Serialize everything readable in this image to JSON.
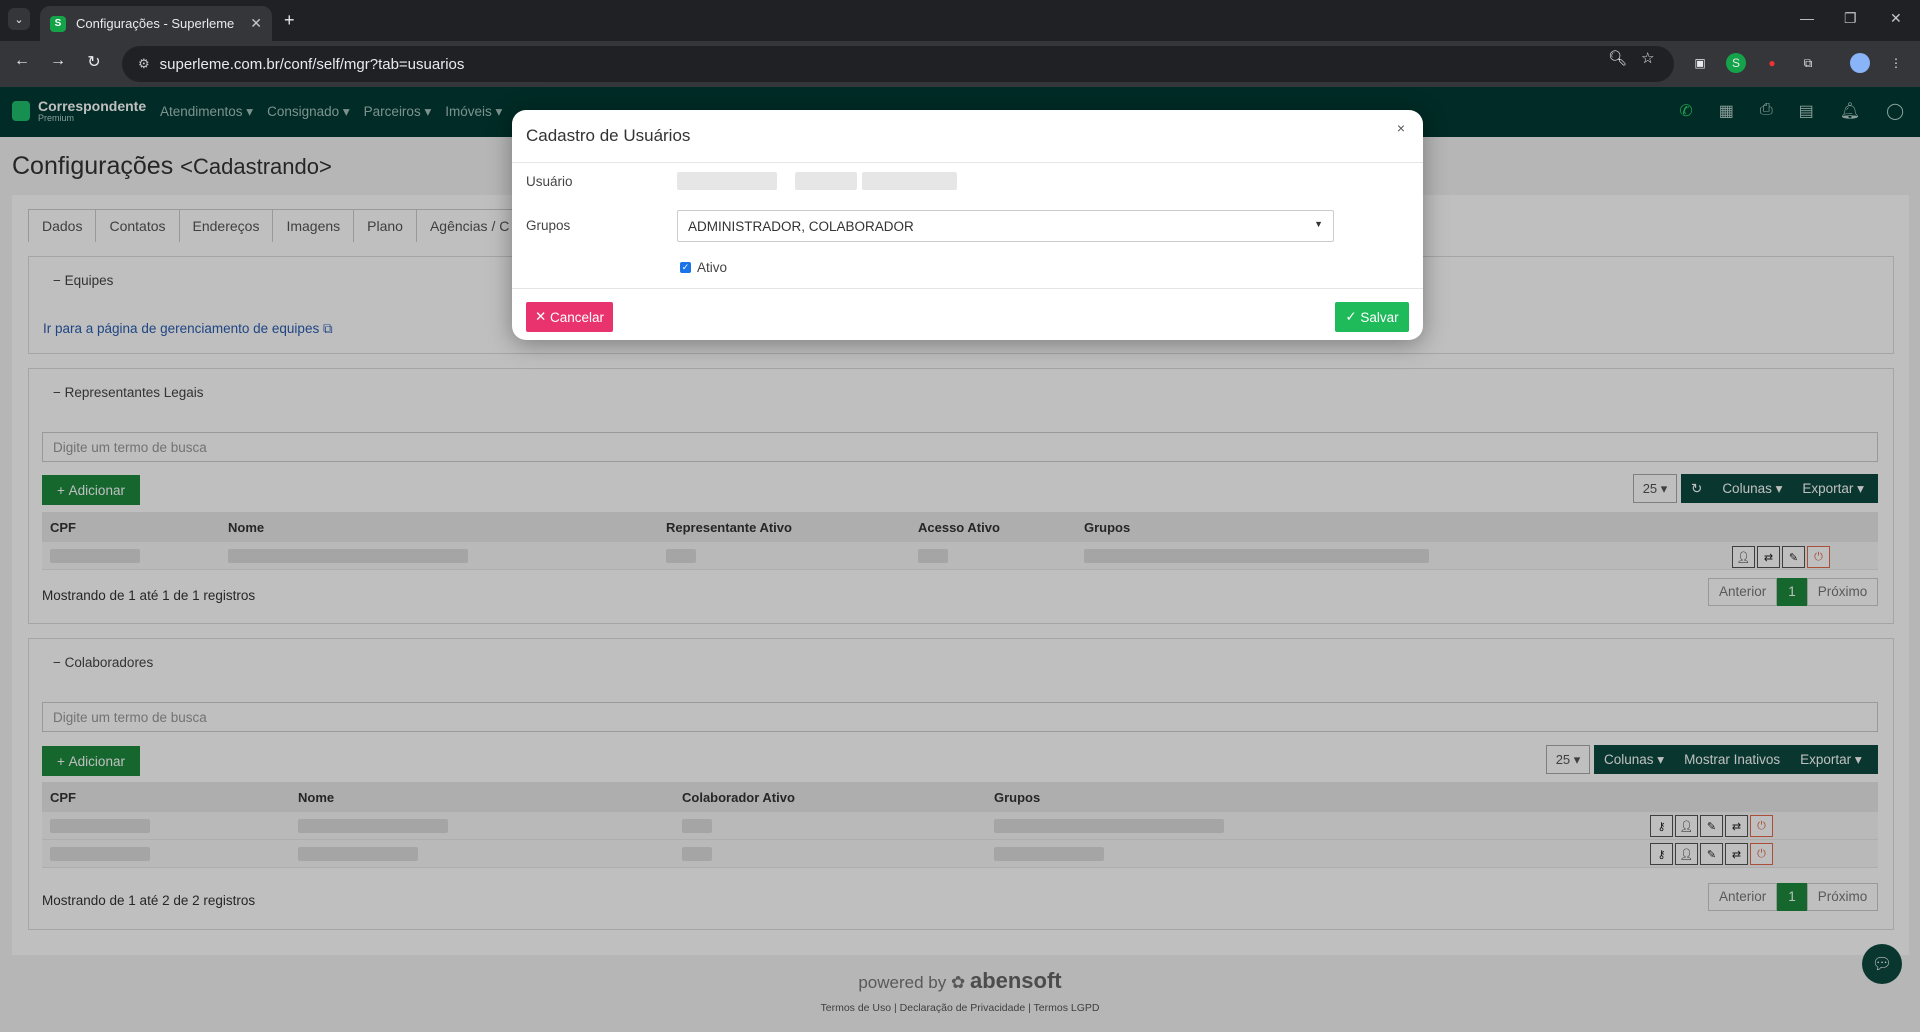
{
  "browser": {
    "tab_title": "Configurações - Superleme",
    "url": "superleme.com.br/conf/self/mgr?tab=usuarios"
  },
  "app": {
    "brand_name": "Correspondente",
    "brand_sub": "Premium",
    "menu": [
      "Atendimentos ▾",
      "Consignado ▾",
      "Parceiros ▾",
      "Imóveis ▾"
    ]
  },
  "page": {
    "title": "Configurações",
    "subtitle": "<Cadastrando>",
    "tabs": [
      "Dados",
      "Contatos",
      "Endereços",
      "Imagens",
      "Plano",
      "Agências / C"
    ]
  },
  "equipes": {
    "header": "Equipes",
    "link": "Ir para a página de gerenciamento de equipes"
  },
  "representantes": {
    "header": "Representantes Legais",
    "search_placeholder": "Digite um termo de busca",
    "add": "Adicionar",
    "page_size": "25 ▾",
    "columns_btn": "Colunas ▾",
    "export_btn": "Exportar ▾",
    "columns": [
      "CPF",
      "Nome",
      "Representante Ativo",
      "Acesso Ativo",
      "Grupos"
    ],
    "info": "Mostrando de 1 até 1 de 1 registros",
    "prev": "Anterior",
    "page": "1",
    "next": "Próximo"
  },
  "colaboradores": {
    "header": "Colaboradores",
    "search_placeholder": "Digite um termo de busca",
    "add": "Adicionar",
    "page_size": "25 ▾",
    "columns_btn": "Colunas ▾",
    "inactive_btn": "Mostrar Inativos",
    "export_btn": "Exportar ▾",
    "columns": [
      "CPF",
      "Nome",
      "Colaborador Ativo",
      "Grupos"
    ],
    "info": "Mostrando de 1 até 2 de 2 registros",
    "prev": "Anterior",
    "page": "1",
    "next": "Próximo"
  },
  "footer": {
    "powered": "powered by",
    "brand": "abensoft",
    "links": [
      "Termos de Uso",
      "Declaração de Privacidade",
      "Termos LGPD"
    ]
  },
  "modal": {
    "title": "Cadastro de Usuários",
    "close": "×",
    "user_label": "Usuário",
    "groups_label": "Grupos",
    "groups_value": "ADMINISTRADOR, COLABORADOR",
    "active_label": "Ativo",
    "cancel": "Cancelar",
    "save": "Salvar"
  }
}
